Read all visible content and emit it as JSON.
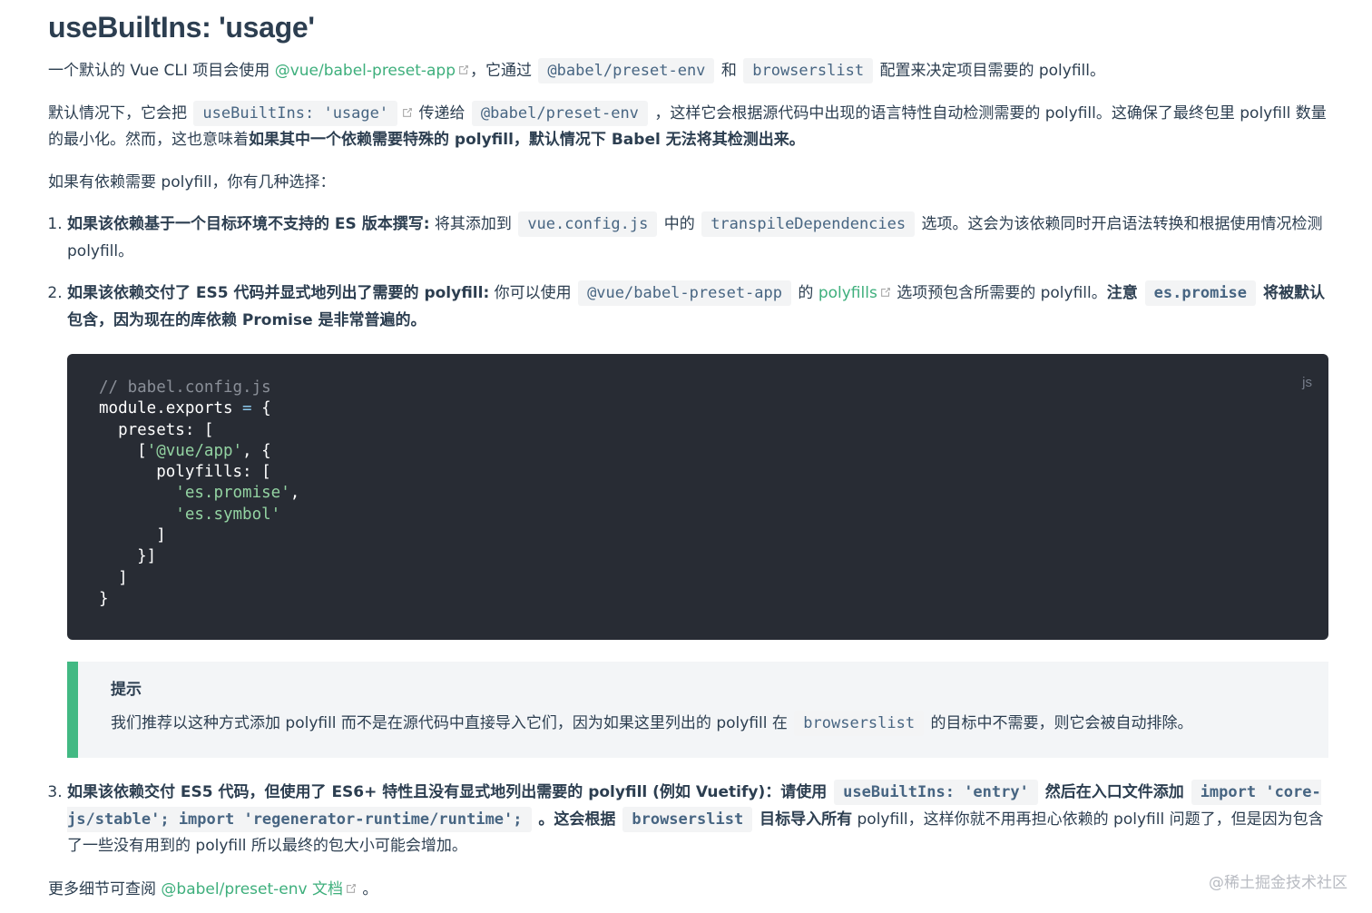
{
  "title": "useBuiltIns: 'usage'",
  "p1": {
    "t1": "一个默认的 Vue CLI 项目会使用 ",
    "link": "@vue/babel-preset-app",
    "t2": "，它通过 ",
    "code1": "@babel/preset-env",
    "t3": " 和 ",
    "code2": "browserslist",
    "t4": " 配置来决定项目需要的 polyfill。"
  },
  "p2": {
    "t1": "默认情况下，它会把 ",
    "code1": "useBuiltIns: 'usage'",
    "t2": " 传递给 ",
    "code2": "@babel/preset-env",
    "t3": " ，这样它会根据源代码中出现的语言特性自动检测需要的 polyfill。这确保了最终包里 polyfill 数量的最小化。然而，这也意味着",
    "bold": "如果其中一个依赖需要特殊的 polyfill，默认情况下 Babel 无法将其检测出来。"
  },
  "p3": "如果有依赖需要 polyfill，你有几种选择：",
  "list": {
    "item1": {
      "bold": "如果该依赖基于一个目标环境不支持的 ES 版本撰写:",
      "t1": " 将其添加到 ",
      "code1": "vue.config.js",
      "t2": " 中的 ",
      "code2": "transpileDependencies",
      "t3": " 选项。这会为该依赖同时开启语法转换和根据使用情况检测 polyfill。"
    },
    "item2": {
      "bold": "如果该依赖交付了 ES5 代码并显式地列出了需要的 polyfill:",
      "t1": " 你可以使用 ",
      "code1": "@vue/babel-preset-app",
      "t2": " 的 ",
      "link": "polyfills",
      "t3": " 选项预包含所需要的 polyfill。",
      "bold2": "注意 ",
      "code2": "es.promise",
      "bold3": " 将被默认包含，因为现在的库依赖 Promise 是非常普遍的。"
    },
    "item3": {
      "bold": "如果该依赖交付 ES5 代码，但使用了 ES6+ 特性且没有显式地列出需要的 polyfill (例如 Vuetify)：请使用 ",
      "code1": "useBuiltIns: 'entry'",
      "bold2": " 然后在入口文件添加 ",
      "code2": "import 'core-js/stable'; import 'regenerator-runtime/runtime';",
      "bold3": " 。这会根据 ",
      "code3": "browserslist",
      "bold4": " 目标导入所有",
      "t1": " polyfill，这样你就不用再担心依赖的 polyfill 问题了，但是因为包含了一些没有用到的 polyfill 所以最终的包大小可能会增加。"
    }
  },
  "code_block": {
    "lang": "js",
    "comment": "// babel.config.js",
    "l2a": "module.exports ",
    "l2op": "=",
    "l2b": " {",
    "l3": "  presets: [",
    "l4a": "    [",
    "l4str": "'@vue/app'",
    "l4b": ", {",
    "l5": "      polyfills: [",
    "l6str": "'es.promise'",
    "l6b": ",",
    "l7str": "'es.symbol'",
    "l8": "      ]",
    "l9": "    }]",
    "l10": "  ]",
    "l11": "}"
  },
  "tip": {
    "title": "提示",
    "t1": "我们推荐以这种方式添加 polyfill 而不是在源代码中直接导入它们，因为如果这里列出的 polyfill 在 ",
    "code1": "browserslist",
    "t2": " 的目标中不需要，则它会被自动排除。"
  },
  "p4": {
    "t1": "更多细节可查阅 ",
    "link": "@babel/preset-env 文档",
    "t2": " 。"
  },
  "watermark": "@稀土掘金技术社区",
  "colors": {
    "link": "#3eaf7c",
    "code_bg": "#282c34",
    "tip_border": "#42b983"
  }
}
